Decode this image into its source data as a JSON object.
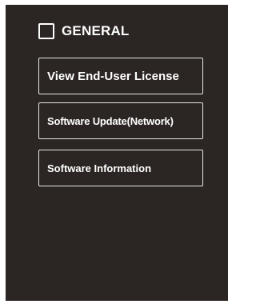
{
  "general": {
    "title": "GENERAL",
    "items": [
      {
        "label": "View End-User License"
      },
      {
        "label": "Software Update(Network)"
      },
      {
        "label": "Software Information"
      }
    ]
  }
}
